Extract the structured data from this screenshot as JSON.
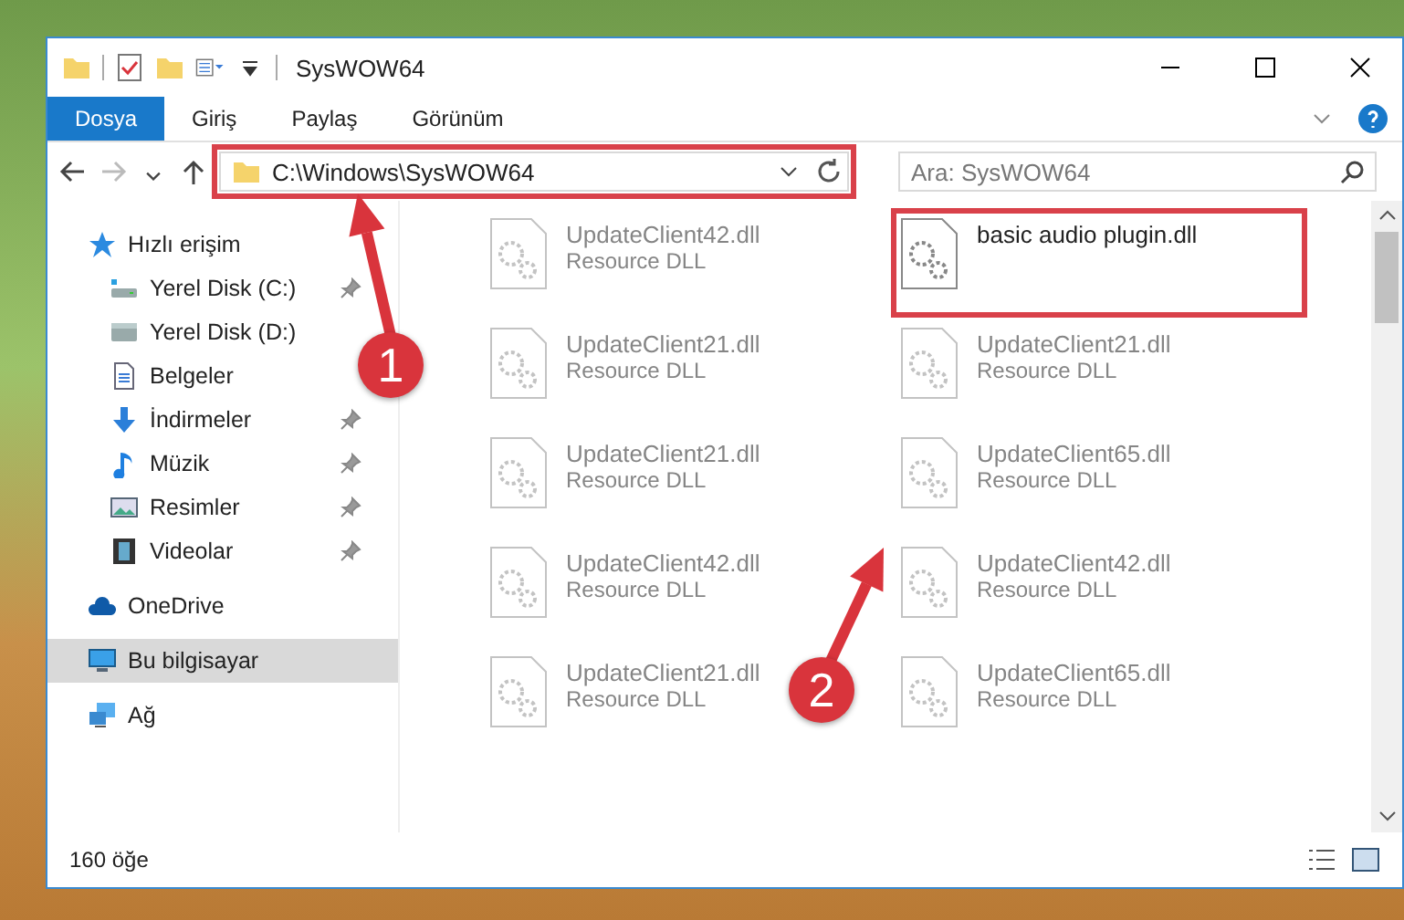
{
  "window": {
    "title": "SysWOW64"
  },
  "ribbon_tabs": [
    {
      "label": "Dosya",
      "selected": true
    },
    {
      "label": "Giriş",
      "selected": false
    },
    {
      "label": "Paylaş",
      "selected": false
    },
    {
      "label": "Görünüm",
      "selected": false
    }
  ],
  "address_bar": {
    "path": "C:\\Windows\\SysWOW64",
    "highlighted": true
  },
  "search": {
    "placeholder": "Ara: SysWOW64"
  },
  "sidebar": {
    "items": [
      {
        "label": "Hızlı erişim",
        "kind": "star",
        "selected": false,
        "children": [
          {
            "label": "Yerel Disk (C:)",
            "kind": "drive-c",
            "pinned": true,
            "selected": false
          },
          {
            "label": "Yerel Disk (D:)",
            "kind": "drive",
            "pinned": false,
            "selected": false
          },
          {
            "label": "Belgeler",
            "kind": "document",
            "pinned": false,
            "selected": false
          },
          {
            "label": "İndirmeler",
            "kind": "download",
            "pinned": true,
            "selected": false
          },
          {
            "label": "Müzik",
            "kind": "music",
            "pinned": true,
            "selected": false
          },
          {
            "label": "Resimler",
            "kind": "picture",
            "pinned": true,
            "selected": false
          },
          {
            "label": "Videolar",
            "kind": "video",
            "pinned": true,
            "selected": false
          }
        ]
      },
      {
        "label": "OneDrive",
        "kind": "cloud",
        "selected": false
      },
      {
        "label": "Bu bilgisayar",
        "kind": "computer",
        "selected": true
      },
      {
        "label": "Ağ",
        "kind": "network",
        "selected": false
      }
    ]
  },
  "files": [
    {
      "name": "UpdateClient42.dll",
      "type": "Resource DLL",
      "blurred": true,
      "highlighted": false
    },
    {
      "name": "UpdateClient21.dll",
      "type": "Resource DLL",
      "blurred": true,
      "highlighted": false
    },
    {
      "name": "UpdateClient21.dll",
      "type": "Resource DLL",
      "blurred": true,
      "highlighted": false
    },
    {
      "name": "UpdateClient42.dll",
      "type": "Resource DLL",
      "blurred": true,
      "highlighted": false
    },
    {
      "name": "UpdateClient21.dll",
      "type": "Resource DLL",
      "blurred": true,
      "highlighted": false
    },
    {
      "name": "basic audio plugin.dll",
      "blurred": false,
      "highlighted": true
    },
    {
      "name": "UpdateClient21.dll",
      "type": "Resource DLL",
      "blurred": true,
      "highlighted": false
    },
    {
      "name": "UpdateClient65.dll",
      "type": "Resource DLL",
      "blurred": true,
      "highlighted": false
    },
    {
      "name": "UpdateClient42.dll",
      "type": "Resource DLL",
      "blurred": true,
      "highlighted": false
    },
    {
      "name": "UpdateClient65.dll",
      "type": "Resource DLL",
      "blurred": true,
      "highlighted": false
    }
  ],
  "status_bar": {
    "item_count": "160 öğe"
  },
  "callouts": [
    {
      "number": "1"
    },
    {
      "number": "2"
    }
  ]
}
